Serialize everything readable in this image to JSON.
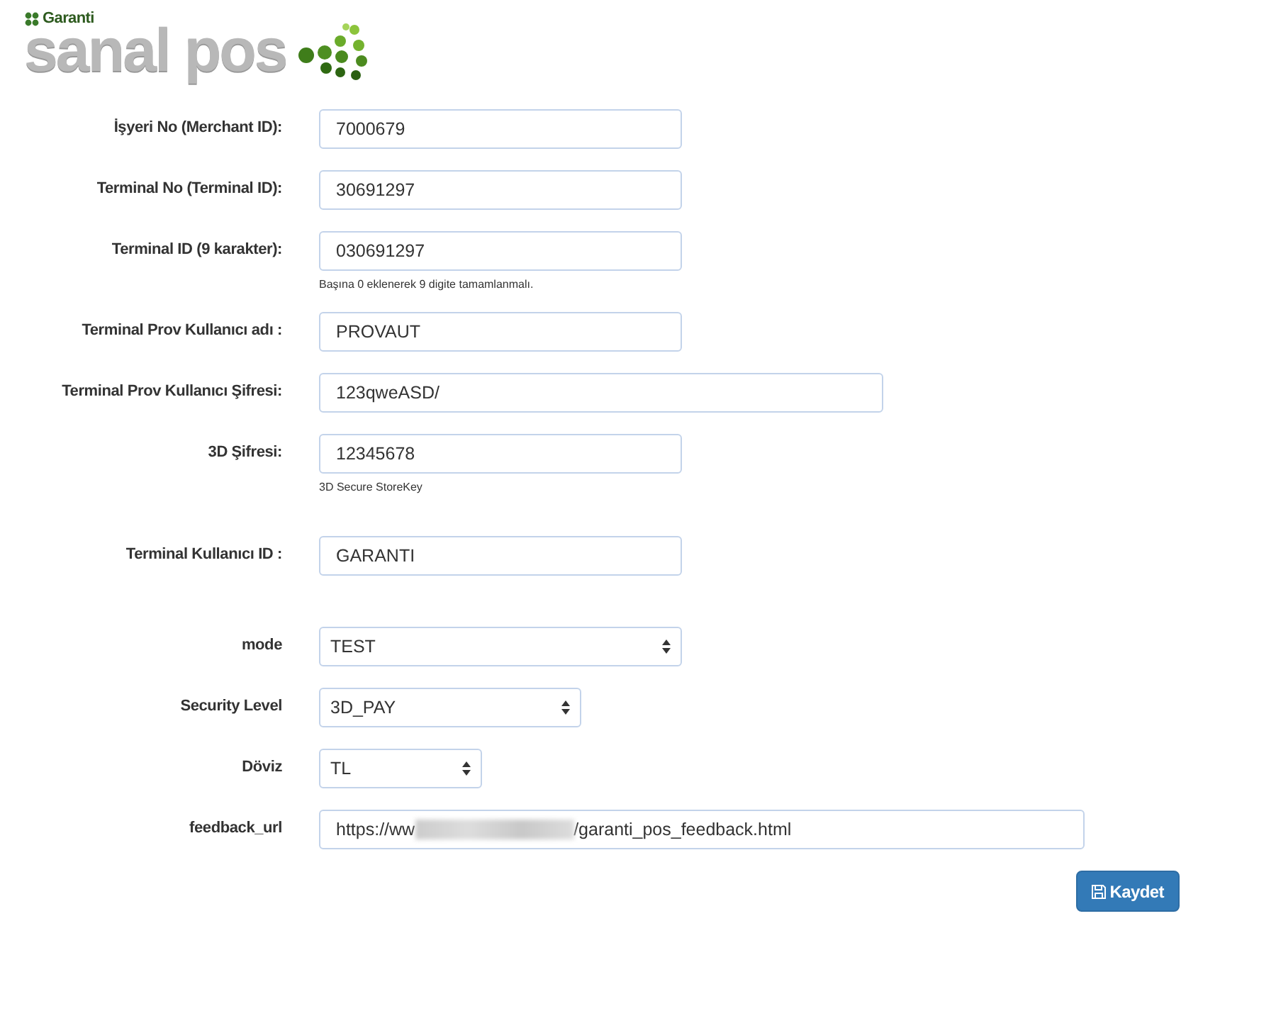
{
  "logo": {
    "bank": "Garanti",
    "product": "sanal pos"
  },
  "fields": [
    {
      "kind": "text",
      "label": "İşyeri No (Merchant ID):",
      "value": "7000679"
    },
    {
      "kind": "text",
      "label": "Terminal No (Terminal ID):",
      "value": "30691297"
    },
    {
      "kind": "text",
      "label": "Terminal ID (9 karakter):",
      "value": "030691297",
      "help": "Başına 0 eklenerek 9 digite tamamlanmalı."
    },
    {
      "kind": "text",
      "label": "Terminal Prov Kullanıcı adı :",
      "value": "PROVAUT"
    },
    {
      "kind": "text",
      "label": "Terminal Prov Kullanıcı Şifresi:",
      "value": "123qweASD/"
    },
    {
      "kind": "text",
      "label": "3D Şifresi:",
      "value": "12345678",
      "help": "3D Secure StoreKey"
    },
    {
      "kind": "text",
      "label": "Terminal Kullanıcı ID :",
      "value": "GARANTI"
    },
    {
      "kind": "select",
      "label": "mode",
      "value": "TEST"
    },
    {
      "kind": "select",
      "label": "Security Level",
      "value": "3D_PAY"
    },
    {
      "kind": "select",
      "label": "Döviz",
      "value": "TL"
    },
    {
      "kind": "url",
      "label": "feedback_url",
      "value_start": "https://ww",
      "value_end": "/garanti_pos_feedback.html",
      "redacted": true
    }
  ],
  "save_button": {
    "label": "Kaydet"
  }
}
